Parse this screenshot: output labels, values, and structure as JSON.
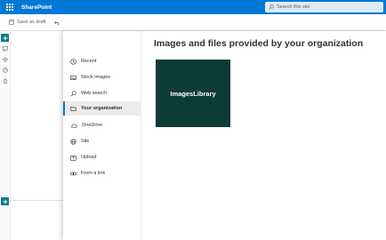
{
  "topbar": {
    "app_name": "SharePoint",
    "search_placeholder": "Search this site",
    "accent": "#0078d4"
  },
  "commandbar": {
    "save_draft": "Save as draft",
    "undo_icon": "undo-icon"
  },
  "picker": {
    "title": "Images and files provided by your organization",
    "nav": [
      {
        "label": "Recent",
        "icon": "clock-icon"
      },
      {
        "label": "Stock images",
        "icon": "image-icon"
      },
      {
        "label": "Web search",
        "icon": "search-icon"
      },
      {
        "label": "Your organization",
        "icon": "folder-icon",
        "active": true
      },
      {
        "label": "OneDrive",
        "icon": "cloud-icon"
      },
      {
        "label": "Site",
        "icon": "globe-icon"
      },
      {
        "label": "Upload",
        "icon": "upload-icon"
      },
      {
        "label": "From a link",
        "icon": "link-icon"
      }
    ],
    "tiles": [
      {
        "label": "ImagesLibrary",
        "color": "#0d3b36"
      }
    ]
  }
}
